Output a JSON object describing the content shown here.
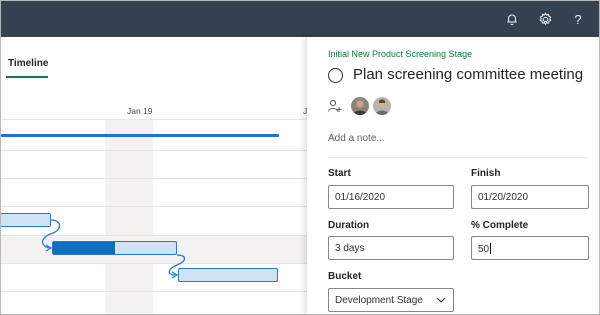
{
  "topbar": {
    "icons": [
      "bell-icon",
      "gear-icon",
      "help-icon"
    ],
    "help_glyph": "?"
  },
  "timeline": {
    "tab_label": "Timeline",
    "date_labels": [
      "Jan 19",
      "J"
    ]
  },
  "task": {
    "bucket_crumb": "Initial New Product Screening Stage",
    "title": "Plan screening committee meeting",
    "note_placeholder": "Add a note...",
    "start_label": "Start",
    "start_value": "01/16/2020",
    "finish_label": "Finish",
    "finish_value": "01/20/2020",
    "duration_label": "Duration",
    "duration_value": "3 days",
    "complete_label": "% Complete",
    "complete_value": "50",
    "bucket_label": "Bucket",
    "bucket_value": "Development Stage"
  },
  "colors": {
    "topbar": "#334150",
    "accent_green": "#107c41",
    "bar_blue": "#106ebe",
    "bar_light": "#cfe3f7"
  }
}
